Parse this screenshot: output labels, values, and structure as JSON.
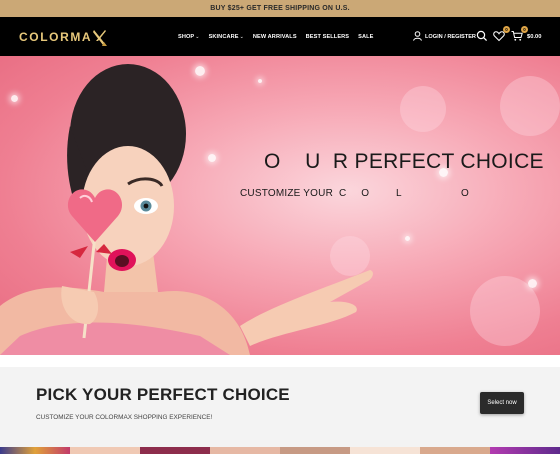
{
  "promo_bar": {
    "text": "BUY $25+ GET FREE SHIPPING ON U.S."
  },
  "header": {
    "logo_text": "COLORMA",
    "nav": [
      {
        "label": "SHOP",
        "has_dropdown": true
      },
      {
        "label": "SKINCARE",
        "has_dropdown": true
      },
      {
        "label": "NEW ARRIVALS",
        "has_dropdown": false
      },
      {
        "label": "BEST SELLERS",
        "has_dropdown": false
      },
      {
        "label": "SALE",
        "has_dropdown": false
      }
    ],
    "account_label": "LOGIN / REGISTER",
    "icons": [
      "user-icon",
      "search-icon",
      "heart-icon",
      "cart-icon"
    ],
    "wishlist_count": "0",
    "cart_count": "0",
    "cart_total": "$0.00"
  },
  "hero": {
    "title": "O    U  R PERFECT CHOICE",
    "subtitle": "CUSTOMIZE YOUR  C     O         L                    O"
  },
  "cta": {
    "title": "PICK YOUR PERFECT CHOICE",
    "subtitle": "CUSTOMIZE YOUR COLORMAX SHOPPING EXPERIENCE!",
    "button_label": "Select now"
  },
  "colors": {
    "promo_bg": "#cba876",
    "header_bg": "#000000",
    "logo_gold": "#e7c87b",
    "badge": "#e0a648",
    "hero_pink": "#f2a0b0",
    "button_bg": "#2b2b2b"
  }
}
